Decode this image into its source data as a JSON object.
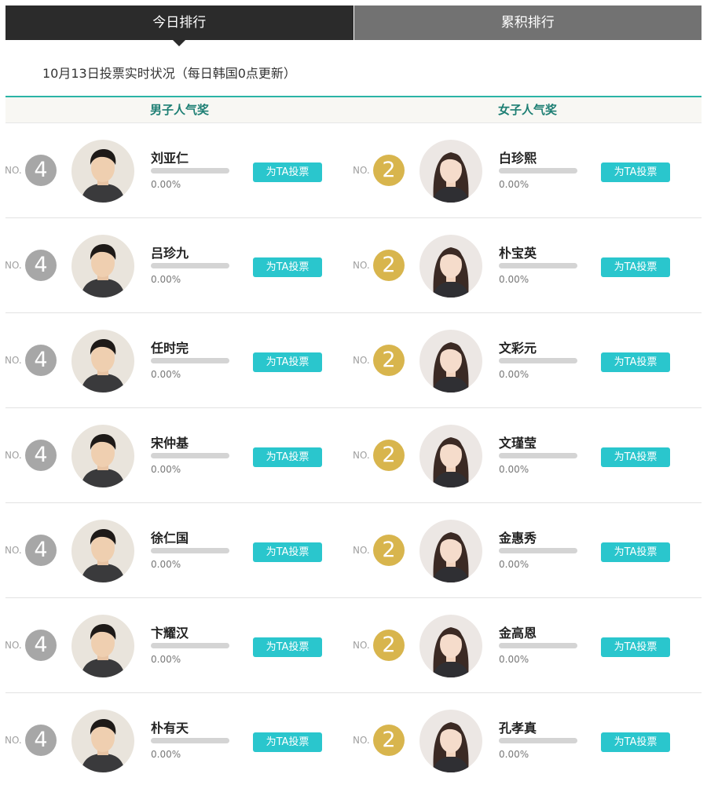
{
  "tabs": [
    {
      "label": "今日排行",
      "active": true
    },
    {
      "label": "累积排行",
      "active": false
    }
  ],
  "status_text": "10月13日投票实时状况（每日韩国0点更新）",
  "categories": {
    "male": "男子人气奖",
    "female": "女子人气奖"
  },
  "no_label": "NO.",
  "vote_label": "为TA投票",
  "colors": {
    "accent": "#2ac6cd",
    "header_green": "#1e7f74",
    "rank_gray": "#a7a7a7",
    "rank_gold": "#d8b54d",
    "tab_active": "#2b2b2b",
    "tab_inactive": "#727272"
  },
  "rows": [
    {
      "male": {
        "rank": "4",
        "name": "刘亚仁",
        "percent": "0.00%",
        "progress": 0,
        "photo": "portrait-photo"
      },
      "female": {
        "rank": "2",
        "name": "白珍熙",
        "percent": "0.00%",
        "progress": 0,
        "photo": "portrait-photo"
      }
    },
    {
      "male": {
        "rank": "4",
        "name": "吕珍九",
        "percent": "0.00%",
        "progress": 0,
        "photo": "portrait-photo"
      },
      "female": {
        "rank": "2",
        "name": "朴宝英",
        "percent": "0.00%",
        "progress": 0,
        "photo": "portrait-photo"
      }
    },
    {
      "male": {
        "rank": "4",
        "name": "任时完",
        "percent": "0.00%",
        "progress": 0,
        "photo": "portrait-photo"
      },
      "female": {
        "rank": "2",
        "name": "文彩元",
        "percent": "0.00%",
        "progress": 0,
        "photo": "portrait-photo"
      }
    },
    {
      "male": {
        "rank": "4",
        "name": "宋仲基",
        "percent": "0.00%",
        "progress": 0,
        "photo": "portrait-photo"
      },
      "female": {
        "rank": "2",
        "name": "文瑾莹",
        "percent": "0.00%",
        "progress": 0,
        "photo": "portrait-photo"
      }
    },
    {
      "male": {
        "rank": "4",
        "name": "徐仁国",
        "percent": "0.00%",
        "progress": 0,
        "photo": "portrait-photo"
      },
      "female": {
        "rank": "2",
        "name": "金惠秀",
        "percent": "0.00%",
        "progress": 0,
        "photo": "portrait-photo"
      }
    },
    {
      "male": {
        "rank": "4",
        "name": "卞耀汉",
        "percent": "0.00%",
        "progress": 0,
        "photo": "portrait-photo"
      },
      "female": {
        "rank": "2",
        "name": "金高恩",
        "percent": "0.00%",
        "progress": 0,
        "photo": "portrait-photo"
      }
    },
    {
      "male": {
        "rank": "4",
        "name": "朴有天",
        "percent": "0.00%",
        "progress": 0,
        "photo": "portrait-photo"
      },
      "female": {
        "rank": "2",
        "name": "孔孝真",
        "percent": "0.00%",
        "progress": 0,
        "photo": "portrait-photo"
      }
    }
  ]
}
